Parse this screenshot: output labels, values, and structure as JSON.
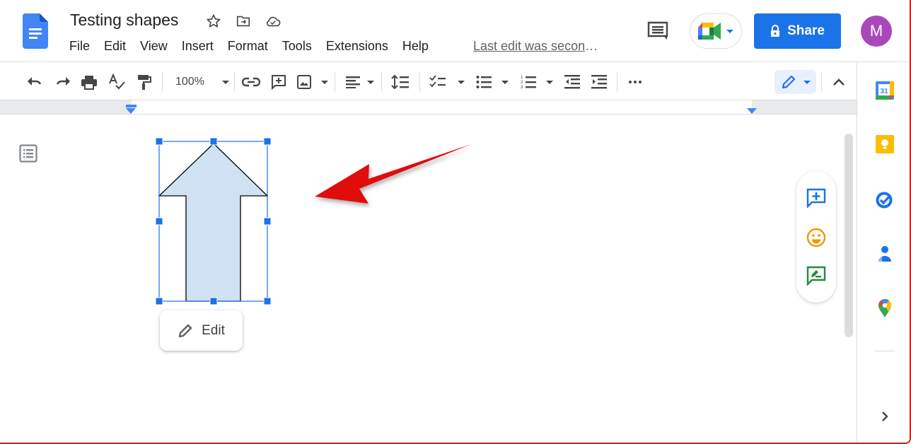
{
  "header": {
    "doc_title": "Testing shapes",
    "last_edit": "Last edit was seconds ago",
    "share_label": "Share",
    "avatar_initial": "M",
    "icons": [
      "docs-logo-icon",
      "star-icon",
      "move-to-folder-icon",
      "cloud-saved-icon",
      "comments-icon",
      "meet-icon",
      "lock-icon"
    ]
  },
  "menu": {
    "items": [
      {
        "label": "File"
      },
      {
        "label": "Edit"
      },
      {
        "label": "View"
      },
      {
        "label": "Insert"
      },
      {
        "label": "Format"
      },
      {
        "label": "Tools"
      },
      {
        "label": "Extensions"
      },
      {
        "label": "Help"
      }
    ]
  },
  "toolbar": {
    "zoom": "100%",
    "buttons": [
      "undo",
      "redo",
      "print",
      "spellcheck",
      "paint-format",
      "zoom",
      "insert-link",
      "add-comment",
      "insert-image",
      "align",
      "line-spacing",
      "checklist",
      "bulleted-list",
      "numbered-list",
      "decrease-indent",
      "increase-indent",
      "more",
      "editing-mode",
      "hide-menus"
    ]
  },
  "canvas": {
    "selected_shape": "up-arrow",
    "shape_fill": "#cfe2f3",
    "selection_color": "#1a73e8",
    "annotation_arrow_color": "#e00000",
    "edit_label": "Edit"
  },
  "side_actions": [
    "add-comment",
    "add-emoji-reaction",
    "suggest-edits"
  ],
  "side_panel": [
    "calendar",
    "keep",
    "tasks",
    "contacts",
    "maps"
  ],
  "colors": {
    "accent": "#1a73e8",
    "avatar": "#ab47bc"
  }
}
